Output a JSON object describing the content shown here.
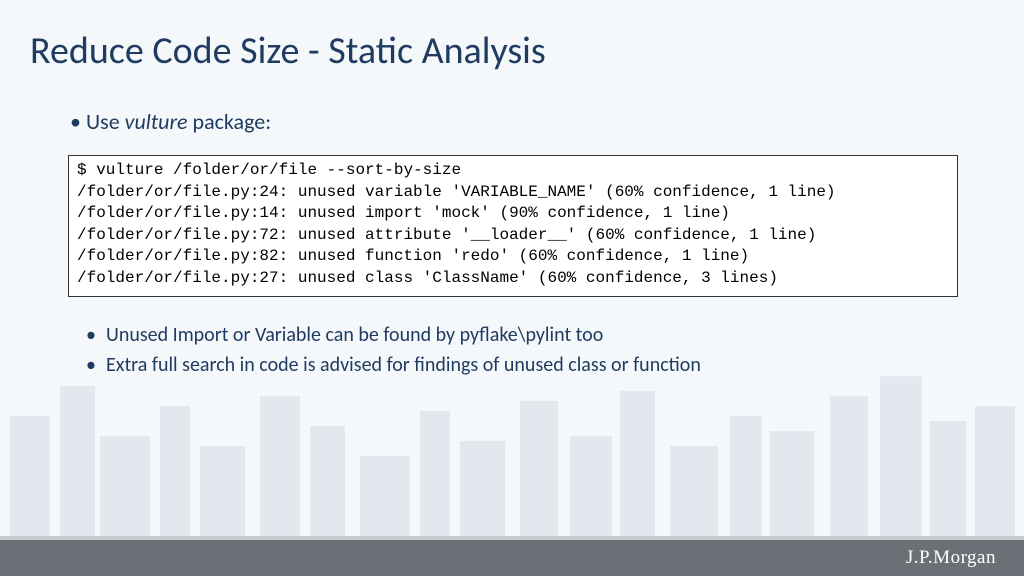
{
  "title": "Reduce Code Size - Static Analysis",
  "bullet_use_prefix": "Use ",
  "bullet_use_package": "vulture",
  "bullet_use_suffix": " package:",
  "code": {
    "l1": "$ vulture /folder/or/file --sort-by-size",
    "l2": "/folder/or/file.py:24: unused variable 'VARIABLE_NAME' (60% confidence, 1 line)",
    "l3": "/folder/or/file.py:14: unused import 'mock' (90% confidence, 1 line)",
    "l4": "/folder/or/file.py:72: unused attribute '__loader__' (60% confidence, 1 line)",
    "l5": "/folder/or/file.py:82: unused function 'redo' (60% confidence, 1 line)",
    "l6": "/folder/or/file.py:27: unused class 'ClassName' (60% confidence, 3 lines)"
  },
  "notes": {
    "n1": "Unused Import or Variable can be found by pyflake\\pylint too",
    "n2": "Extra full search in code is advised for findings of unused class or function"
  },
  "footer_brand": "J.P.Morgan"
}
